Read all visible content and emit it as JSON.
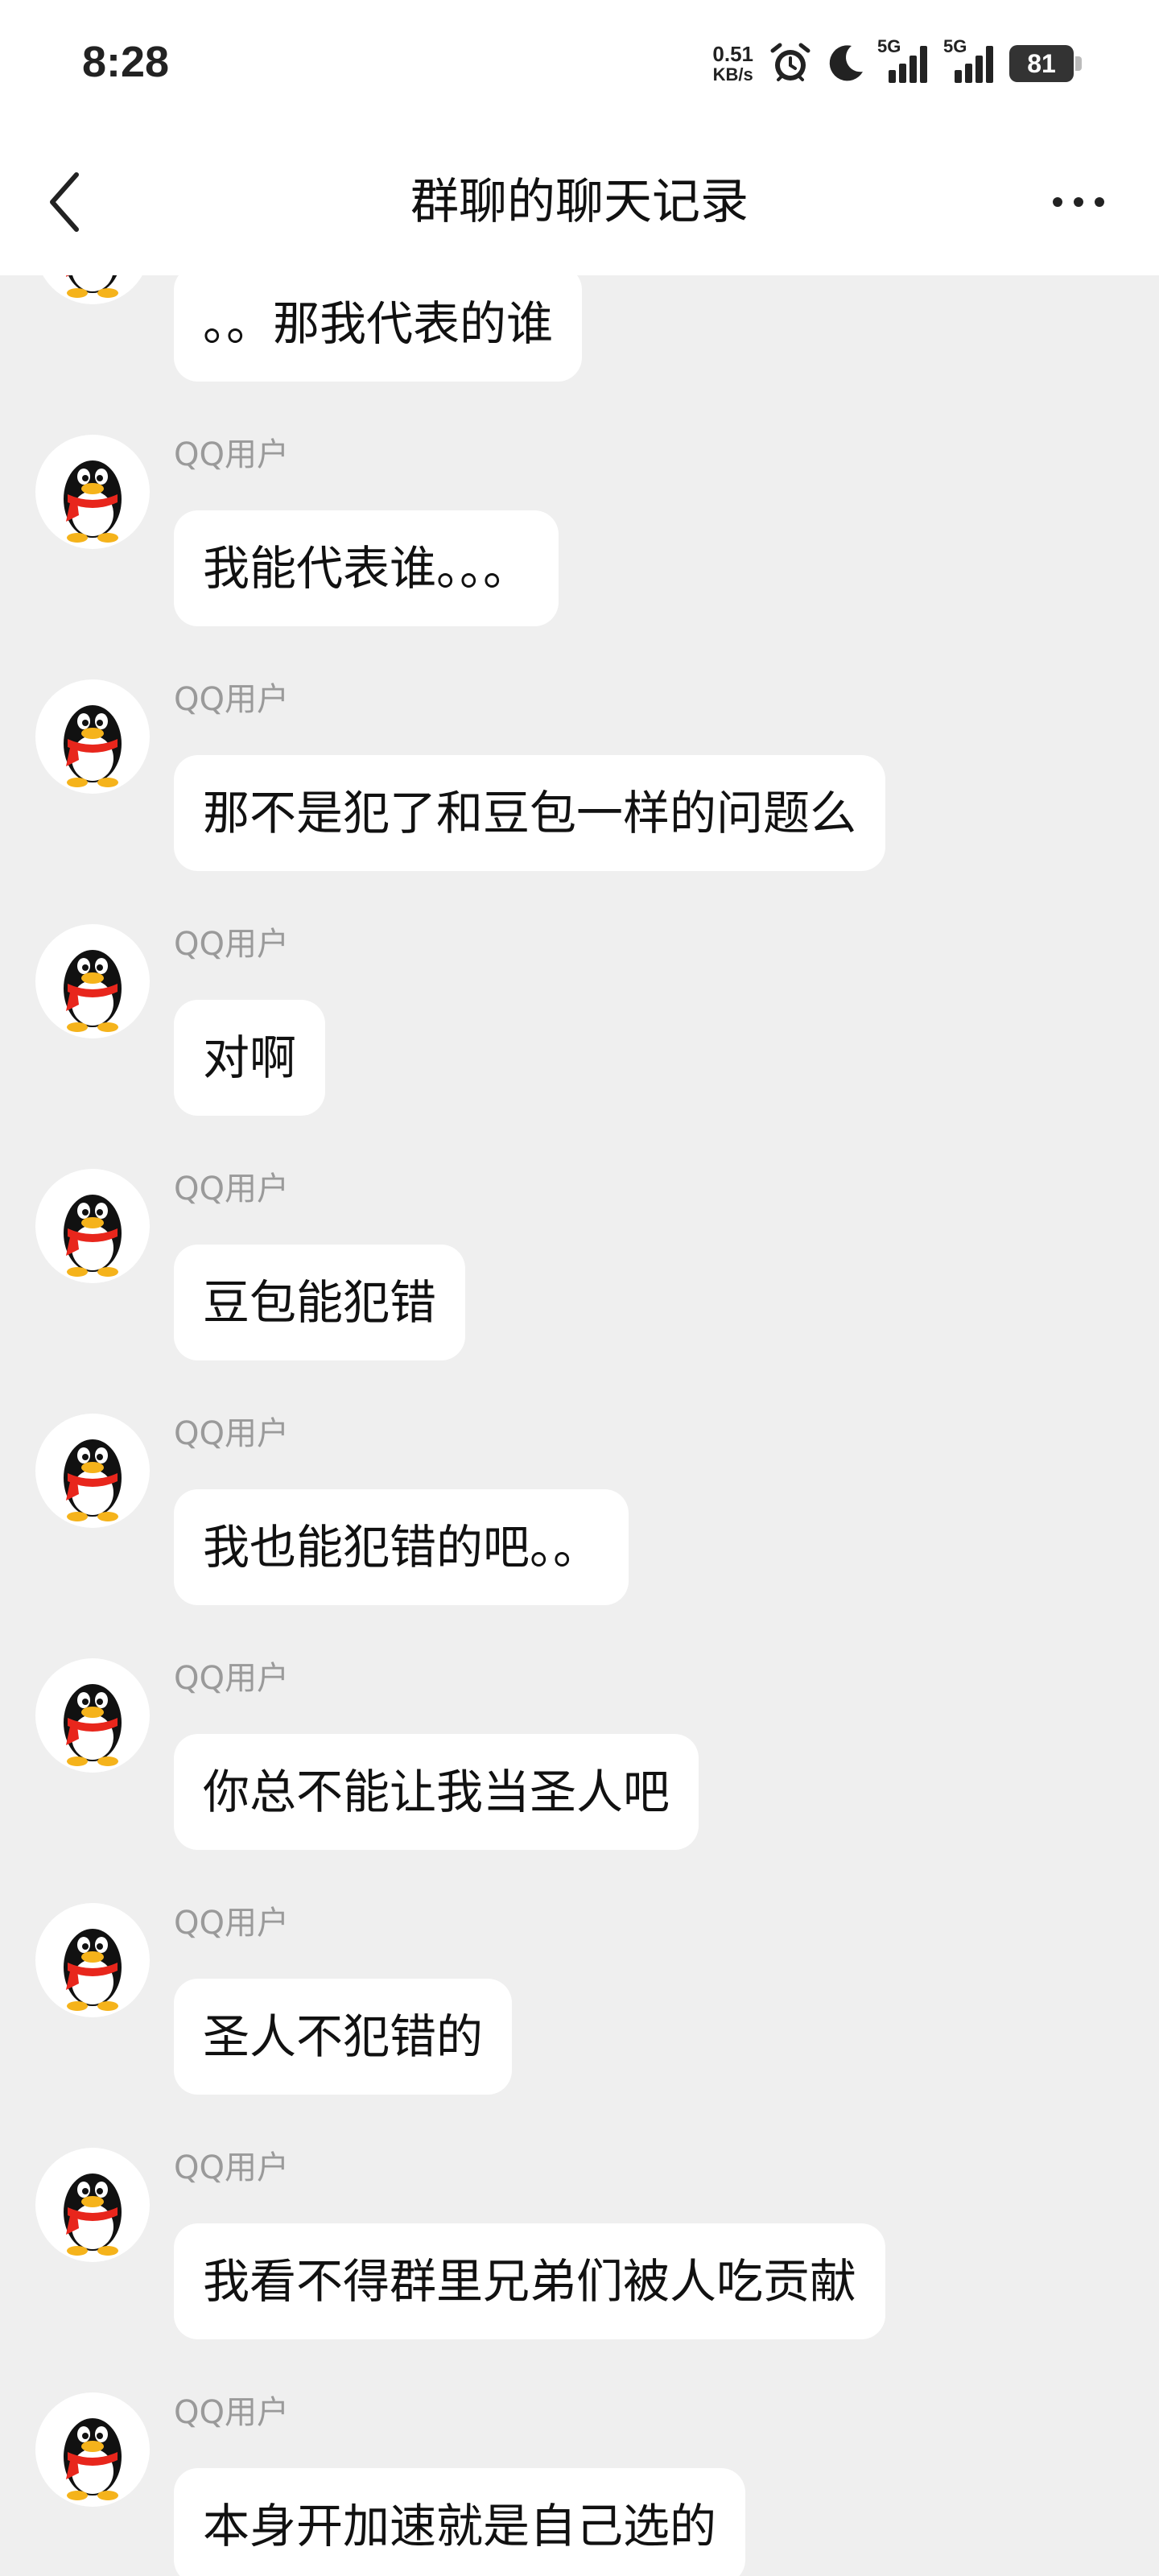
{
  "status_bar": {
    "time": "8:28",
    "net_speed_value": "0.51",
    "net_speed_unit": "KB/s",
    "sim1_label": "5G",
    "sim2_label": "5G",
    "battery": "81",
    "icons": [
      "alarm-icon",
      "moon-icon",
      "signal-icon",
      "signal-icon",
      "battery-icon"
    ]
  },
  "nav": {
    "title": "群聊的聊天记录",
    "back_icon": "chevron-left-icon",
    "more_icon": "more-dots-icon"
  },
  "messages": [
    {
      "sender": "",
      "text": "。。那我代表的谁"
    },
    {
      "sender": "QQ用户",
      "text": "我能代表谁。。。"
    },
    {
      "sender": "QQ用户",
      "text": "那不是犯了和豆包一样的问题么"
    },
    {
      "sender": "QQ用户",
      "text": "对啊"
    },
    {
      "sender": "QQ用户",
      "text": "豆包能犯错"
    },
    {
      "sender": "QQ用户",
      "text": "我也能犯错的吧。。"
    },
    {
      "sender": "QQ用户",
      "text": "你总不能让我当圣人吧"
    },
    {
      "sender": "QQ用户",
      "text": "圣人不犯错的"
    },
    {
      "sender": "QQ用户",
      "text": "我看不得群里兄弟们被人吃贡献"
    },
    {
      "sender": "QQ用户",
      "text": "本身开加速就是自己选的"
    }
  ],
  "colors": {
    "background": "#efefef",
    "bubble": "#ffffff",
    "sender_text": "#9a9a9a",
    "penguin_scarf": "#e8261c",
    "penguin_beak": "#f5b31b"
  }
}
